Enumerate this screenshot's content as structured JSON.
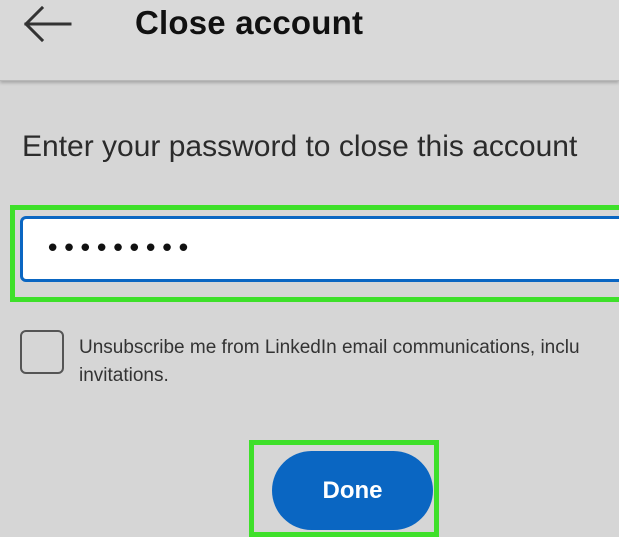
{
  "header": {
    "back_icon": "arrow-left-icon",
    "title": "Close account"
  },
  "form": {
    "prompt": "Enter your password to close this account",
    "password_value": "•••••••••",
    "checkbox_checked": false,
    "checkbox_label_line1": "Unsubscribe me from LinkedIn email communications, inclu",
    "checkbox_label_line2": "invitations.",
    "done_label": "Done"
  },
  "colors": {
    "accent": "#0a66c2",
    "highlight": "#3ee02a",
    "background": "#d6d6d6"
  }
}
